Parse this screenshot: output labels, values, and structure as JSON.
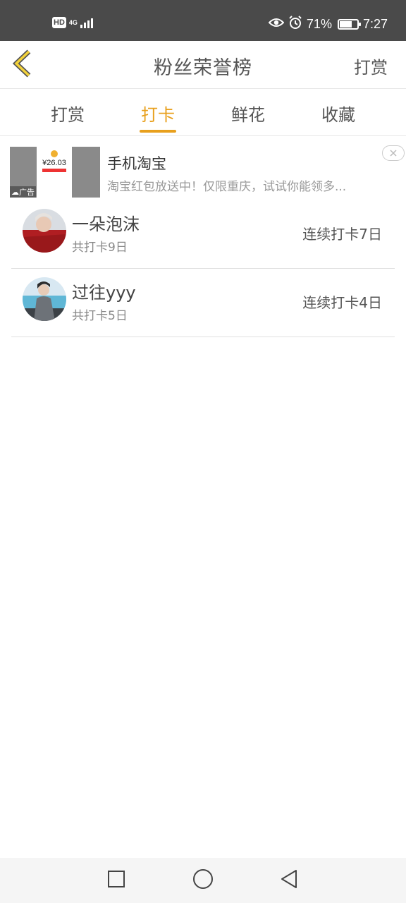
{
  "status_bar": {
    "hd": "HD",
    "network": "4G",
    "battery_percent": "71%",
    "battery_level": 0.71,
    "time": "7:27"
  },
  "header": {
    "title": "粉丝荣誉榜",
    "right_action": "打赏"
  },
  "tabs": [
    {
      "label": "打赏",
      "active": false
    },
    {
      "label": "打卡",
      "active": true
    },
    {
      "label": "鲜花",
      "active": false
    },
    {
      "label": "收藏",
      "active": false
    }
  ],
  "accent_color": "#e8a01d",
  "ad": {
    "thumb_amount": "26.03",
    "tag": "广告",
    "title": "手机淘宝",
    "description": "淘宝红包放送中！仅限重庆，试试你能领多..."
  },
  "list": [
    {
      "name": "一朵泡沫",
      "total": "共打卡9日",
      "streak": "连续打卡7日"
    },
    {
      "name": "过往yyy",
      "total": "共打卡5日",
      "streak": "连续打卡4日"
    }
  ]
}
